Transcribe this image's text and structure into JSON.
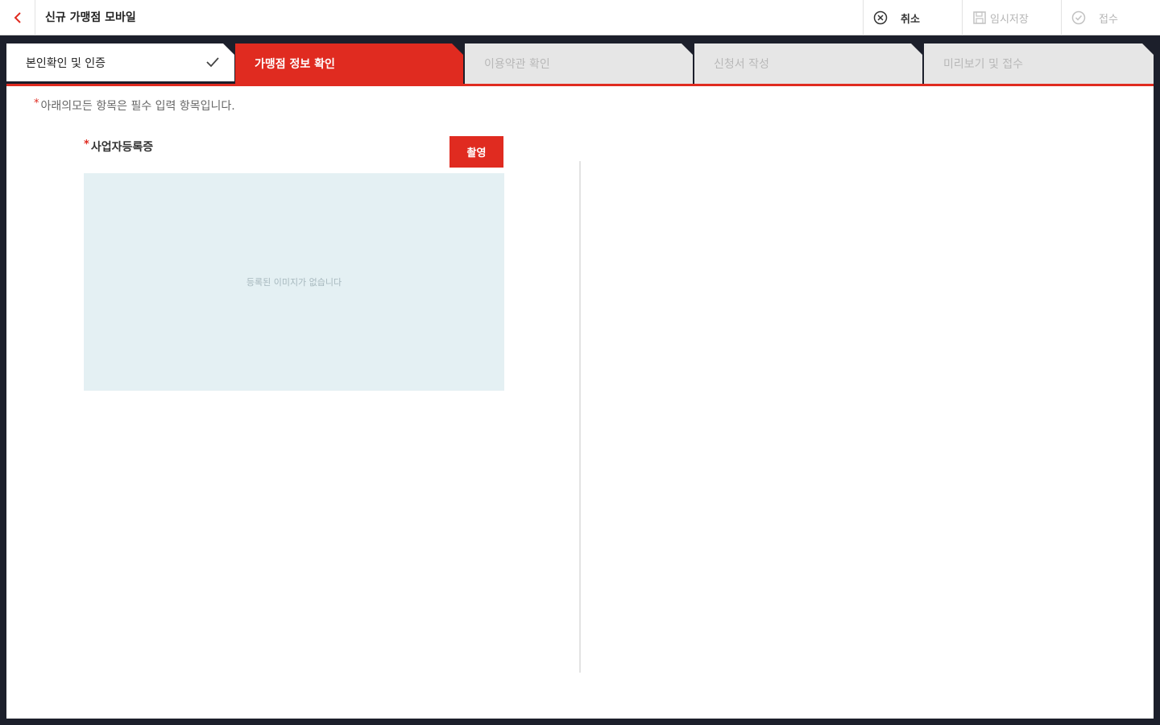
{
  "header": {
    "title": "신규 가맹점 모바일",
    "cancel_label": "취소",
    "save_label": "임시저장",
    "submit_label": "접수"
  },
  "steps": [
    {
      "label": "본인확인 및 인증",
      "state": "done"
    },
    {
      "label": "가맹점 정보 확인",
      "state": "active"
    },
    {
      "label": "이용약관 확인",
      "state": "todo"
    },
    {
      "label": "신청서 작성",
      "state": "todo"
    },
    {
      "label": "미리보기 및 접수",
      "state": "todo"
    }
  ],
  "form": {
    "notice": "아래의모든 항목은 필수 입력 항목입니다.",
    "required_mark": "*",
    "business_reg_label": "사업자등록증",
    "capture_button": "촬영",
    "empty_image_text": "등록된 이미지가 없습니다"
  },
  "colors": {
    "accent": "#e02b20",
    "frame": "#1c1f2b",
    "image_placeholder_bg": "#e4f0f3",
    "inactive_step": "#e6e6e6"
  },
  "icons": {
    "back": "chevron-left-icon",
    "cancel": "circle-x-icon",
    "save": "floppy-disk-icon",
    "submit": "circle-check-icon",
    "step_done": "checkmark-icon"
  }
}
